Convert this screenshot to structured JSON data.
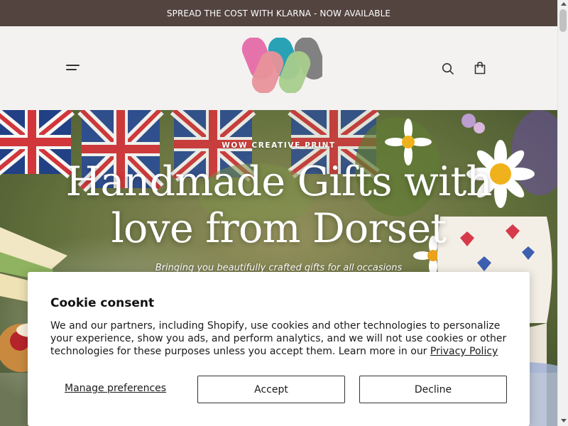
{
  "announcement": {
    "text": "SPREAD THE COST WITH KLARNA - NOW AVAILABLE",
    "background": "#53443f"
  },
  "header": {
    "menu_icon": "hamburger-menu-icon",
    "logo_colors": [
      "#e56aa8",
      "#1e9db2",
      "#7a7a7a",
      "#e8929a",
      "#a8cc8c"
    ],
    "search_icon": "search-icon",
    "cart_icon": "shopping-bag-icon"
  },
  "hero": {
    "eyebrow": "WOW CREATIVE PRINT",
    "title": "Handmade Gifts with love from Dorset",
    "subtitle": "Bringing you beautifully crafted gifts for all occasions"
  },
  "cookie": {
    "title": "Cookie consent",
    "body": "We and our partners, including Shopify, use cookies and other technologies to personalize your experience, show you ads, and perform analytics, and we will not use cookies or other technologies for these purposes unless you accept them. Learn more in our",
    "privacy_link": "Privacy Policy",
    "manage_label": "Manage preferences",
    "accept_label": "Accept",
    "decline_label": "Decline"
  }
}
